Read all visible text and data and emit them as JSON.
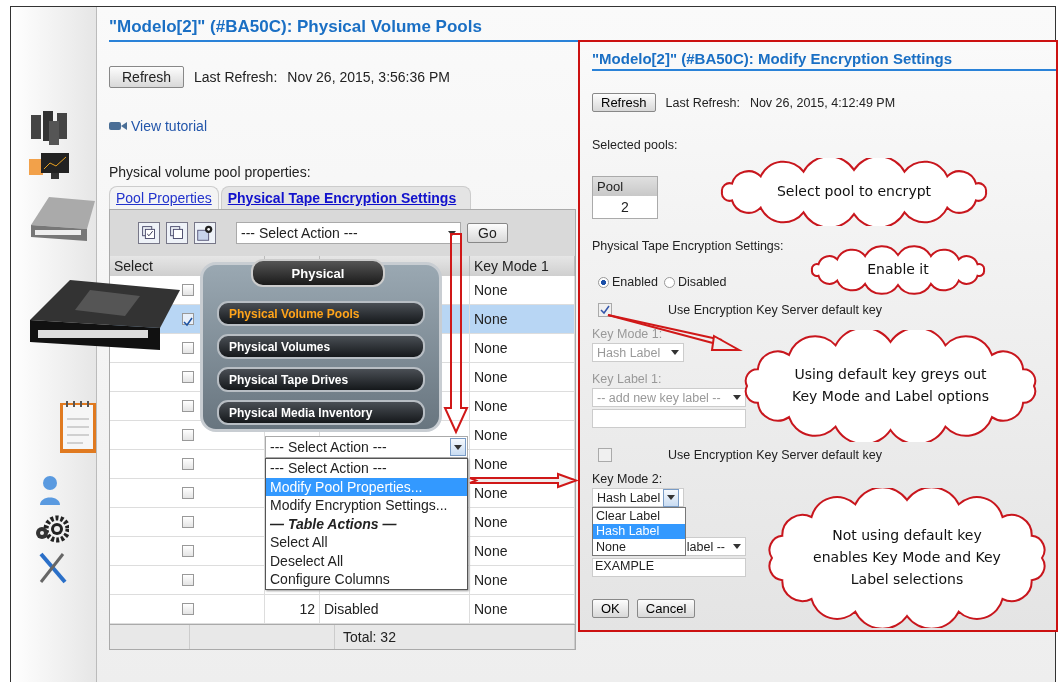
{
  "page": {
    "title": "\"Modelo[2]\" (#BA50C): Physical Volume Pools",
    "refresh_button": "Refresh",
    "last_refresh_label": "Last Refresh:",
    "last_refresh_value": "Nov 26, 2015, 3:56:36 PM",
    "tutorial_link": "View tutorial",
    "section_label": "Physical volume pool properties:"
  },
  "tabs": [
    {
      "label": "Pool Properties",
      "selected": false
    },
    {
      "label": "Physical Tape Encryption Settings",
      "selected": true
    }
  ],
  "toolbar": {
    "action_select": "--- Select Action ---",
    "go_button": "Go"
  },
  "table": {
    "column_headers": {
      "select": "Select",
      "column_4": "Key Mode 1"
    },
    "rows": [
      {
        "checked": false,
        "selected": false,
        "key_mode": "None"
      },
      {
        "checked": true,
        "selected": true,
        "key_mode": "None"
      },
      {
        "checked": false,
        "selected": false,
        "key_mode": "None"
      },
      {
        "checked": false,
        "selected": false,
        "key_mode": "None"
      },
      {
        "checked": false,
        "selected": false,
        "key_mode": "None"
      },
      {
        "checked": false,
        "selected": false,
        "key_mode": "None"
      },
      {
        "checked": false,
        "selected": false,
        "key_mode": "None"
      },
      {
        "checked": false,
        "selected": false,
        "key_mode": "None"
      },
      {
        "checked": false,
        "selected": false,
        "key_mode": "None"
      },
      {
        "checked": false,
        "selected": false,
        "key_mode": "None"
      },
      {
        "checked": false,
        "selected": false,
        "key_mode": "None"
      },
      {
        "checked": false,
        "selected": false,
        "number": "12",
        "status": "Disabled",
        "key_mode": "None"
      }
    ],
    "total": "Total: 32"
  },
  "popup": {
    "title": "Physical",
    "items": [
      {
        "label": "Physical Volume Pools",
        "selected": true
      },
      {
        "label": "Physical Volumes",
        "selected": false
      },
      {
        "label": "Physical Tape Drives",
        "selected": false
      },
      {
        "label": "Physical Media Inventory",
        "selected": false
      }
    ]
  },
  "dropdown": {
    "value": "--- Select Action ---",
    "options": [
      {
        "label": "--- Select Action ---",
        "kind": "option",
        "highlighted": false
      },
      {
        "label": "Modify Pool Properties...",
        "kind": "option",
        "highlighted": true
      },
      {
        "label": "Modify Encryption Settings...",
        "kind": "option",
        "highlighted": false
      },
      {
        "label": "— Table Actions —",
        "kind": "heading"
      },
      {
        "label": "Select All",
        "kind": "option",
        "highlighted": false
      },
      {
        "label": "Deselect All",
        "kind": "option",
        "highlighted": false
      },
      {
        "label": "Configure Columns",
        "kind": "option",
        "highlighted": false
      }
    ]
  },
  "dialog": {
    "title": "\"Modelo[2]\" (#BA50C): Modify Encryption Settings",
    "refresh_button": "Refresh",
    "last_refresh_label": "Last Refresh:",
    "last_refresh_value": "Nov 26, 2015, 4:12:49 PM",
    "selected_pools_label": "Selected pools:",
    "pool_column": "Pool",
    "pool_value": "2",
    "encryption_label": "Physical Tape Encryption Settings:",
    "radios": [
      {
        "label": "Enabled",
        "selected": true
      },
      {
        "label": "Disabled",
        "selected": false
      }
    ],
    "key_1": {
      "default_key_label": "Use Encryption Key Server default key",
      "default_key_checked": true,
      "disabled": true,
      "mode_label": "Key Mode 1:",
      "mode_value": "Hash Label",
      "label_label": "Key Label 1:",
      "label_value": "-- add new key label --"
    },
    "key_2": {
      "default_key_label": "Use Encryption Key Server default key",
      "default_key_checked": false,
      "disabled": false,
      "mode_label": "Key Mode 2:",
      "mode_value": "Hash Label",
      "mode_options": [
        {
          "label": "Clear Label",
          "selected": false
        },
        {
          "label": "Hash Label",
          "selected": true
        },
        {
          "label": "None",
          "selected": false
        }
      ],
      "label_value": "label --",
      "label_input": "EXAMPLE"
    },
    "ok_button": "OK",
    "cancel_button": "Cancel"
  },
  "callouts": [
    {
      "text": "Select pool to encrypt"
    },
    {
      "text": "Enable it"
    },
    {
      "text": "Using default key greys out Key Mode and Label options"
    },
    {
      "text": "Not using default key enables Key Mode and Key Label selections"
    }
  ]
}
